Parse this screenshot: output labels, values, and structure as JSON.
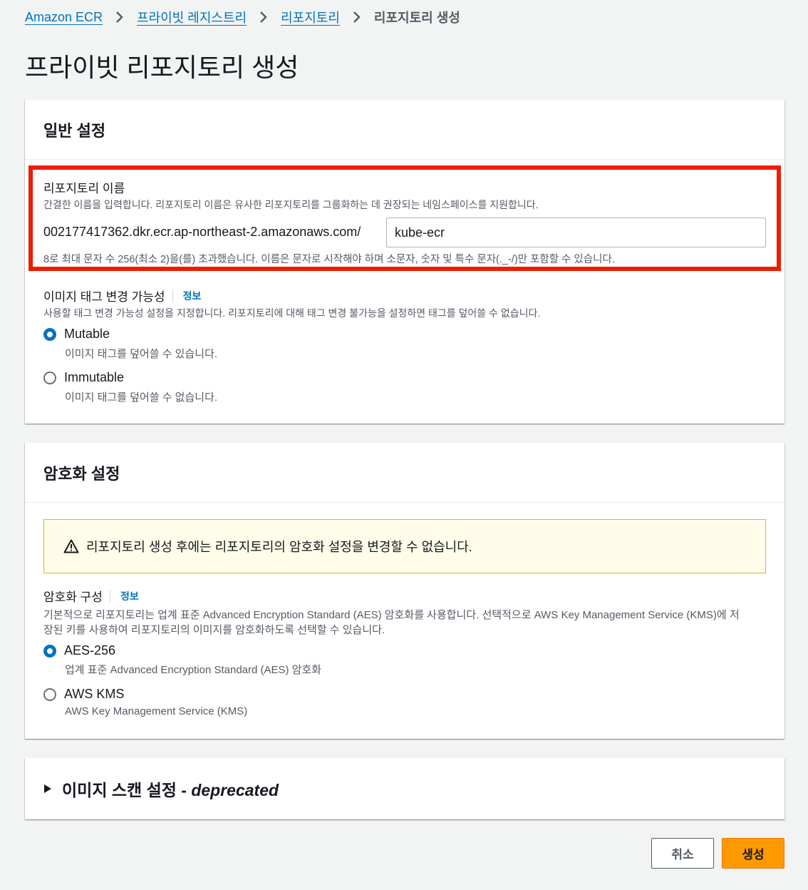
{
  "breadcrumb": {
    "items": [
      "Amazon ECR",
      "프라이빗 레지스트리",
      "리포지토리"
    ],
    "current": "리포지토리 생성"
  },
  "page_title": "프라이빗 리포지토리 생성",
  "general": {
    "header": "일반 설정",
    "repo_name_label": "리포지토리 이름",
    "repo_name_desc": "간결한 이름을 입력합니다. 리포지토리 이름은 유사한 리포지토리를 그룹화하는 데 권장되는 네임스페이스를 지원합니다.",
    "repo_prefix": "002177417362.dkr.ecr.ap-northeast-2.amazonaws.com/",
    "repo_name_value": "kube-ecr",
    "repo_name_constraint": "8로 최대 문자 수 256(최소 2)을(를) 초과했습니다. 이름은 문자로 시작해야 하며 소문자, 숫자 및 특수 문자(._-/)만 포함할 수 있습니다.",
    "tag_label": "이미지 태그 변경 가능성",
    "info": "정보",
    "tag_desc": "사용할 태그 변경 가능성 설정을 지정합니다. 리포지토리에 대해 태그 변경 불가능을 설정하면 태그를 덮어쓸 수 없습니다.",
    "mutable_label": "Mutable",
    "mutable_desc": "이미지 태그를 덮어쓸 수 있습니다.",
    "immutable_label": "Immutable",
    "immutable_desc": "이미지 태그를 덮어쓸 수 없습니다."
  },
  "encryption": {
    "header": "암호화 설정",
    "warning": "리포지토리 생성 후에는 리포지토리의 암호화 설정을 변경할 수 없습니다.",
    "config_label": "암호화 구성",
    "info": "정보",
    "desc_line1": "기본적으로 리포지토리는 업계 표준 Advanced Encryption Standard (AES) 암호화를 사용합니다. 선택적으로 AWS Key Management Service (KMS)에 저",
    "desc_line2": "장된 키를 사용하여 리포지토리의 이미지를 암호화하도록 선택할 수 있습니다.",
    "aes_label": "AES-256",
    "aes_desc": "업계 표준 Advanced Encryption Standard (AES) 암호화",
    "kms_label": "AWS KMS",
    "kms_desc": "AWS Key Management Service (KMS)"
  },
  "scan": {
    "title": "이미지 스캔 설정 - ",
    "title_em": "deprecated"
  },
  "actions": {
    "cancel": "취소",
    "create": "생성"
  },
  "colors": {
    "link": "#0073bb",
    "primary_button": "#ff9900",
    "highlight": "#ee1c00",
    "warning_bg": "#fffce9"
  }
}
